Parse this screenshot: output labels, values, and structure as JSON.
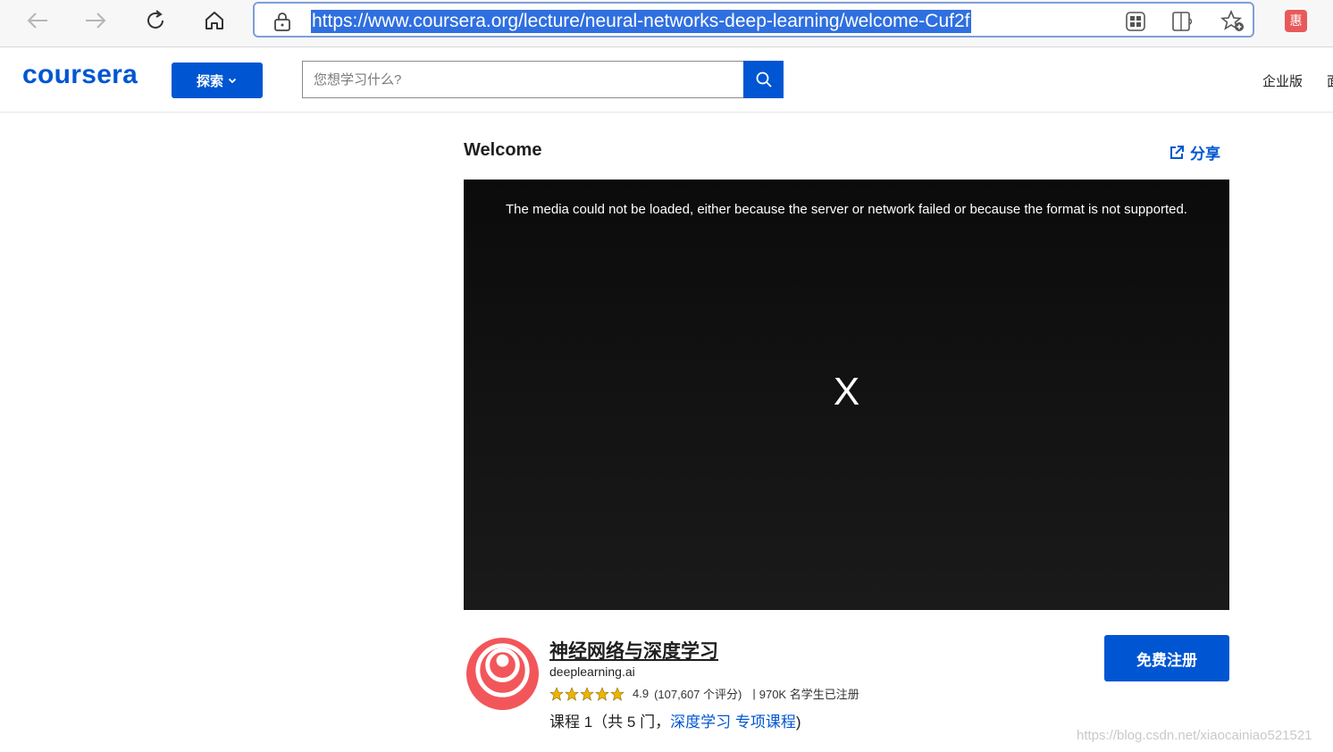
{
  "browser": {
    "url": "https://www.coursera.org/lecture/neural-networks-deep-learning/welcome-Cuf2f",
    "extension_badge": "惠"
  },
  "header": {
    "logo": "coursera",
    "explore_label": "探索",
    "search_placeholder": "您想学习什么?",
    "enterprise_label": "企业版",
    "more_label": "面"
  },
  "lecture": {
    "title": "Welcome",
    "share_label": "分享"
  },
  "video": {
    "error_message": "The media could not be loaded, either because the server or network failed or because the format is not supported.",
    "error_symbol": "X"
  },
  "course": {
    "name": "神经网络与深度学习",
    "partner": "deeplearning.ai",
    "rating": "4.9",
    "rating_count": "(107,607 个评分)",
    "enrolled": "970K 名学生已注册",
    "meta_prefix": "课程 1（共 5 门，",
    "specialization": "深度学习 专项课程",
    "meta_suffix": ")",
    "enroll_label": "免费注册",
    "stars": 5
  },
  "colors": {
    "brand": "#0056d2",
    "star": "#f0b400",
    "logo_red": "#f2565a"
  },
  "watermark": "https://blog.csdn.net/xiaocainiao521521"
}
